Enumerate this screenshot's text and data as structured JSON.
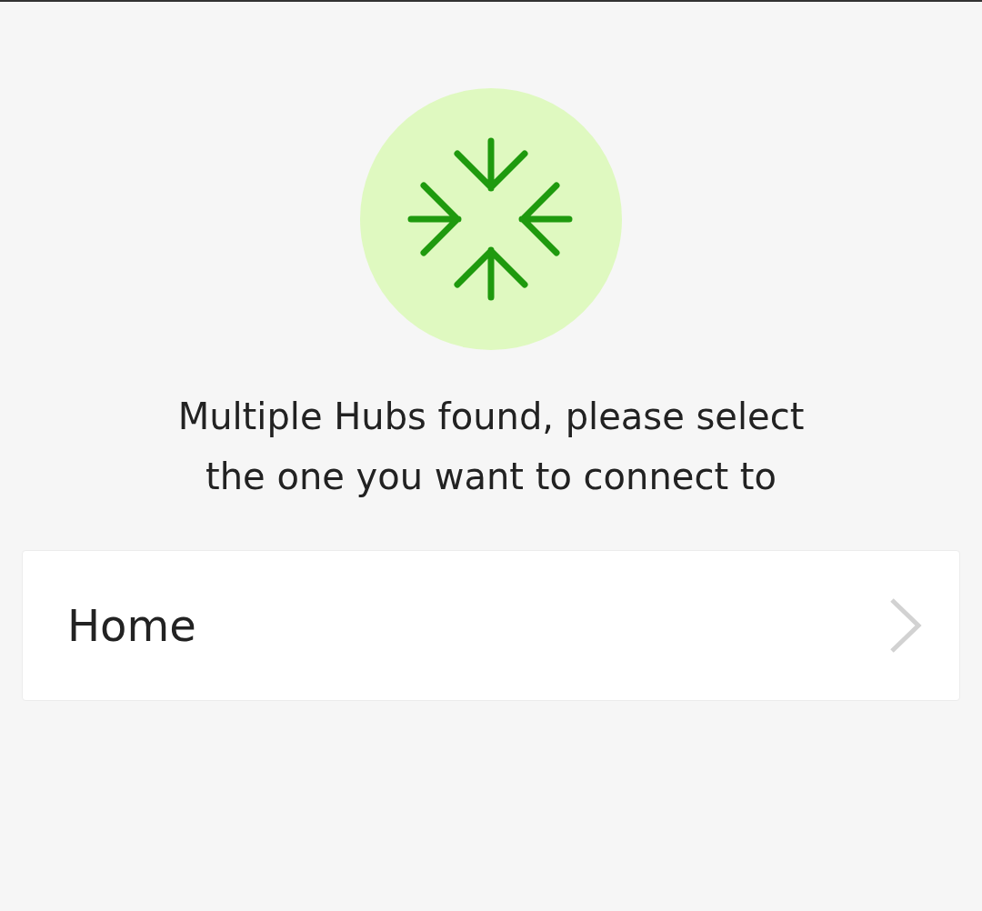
{
  "message": "Multiple Hubs found, please select  the one you want to connect to",
  "hubs": [
    {
      "name": "Home"
    }
  ]
}
